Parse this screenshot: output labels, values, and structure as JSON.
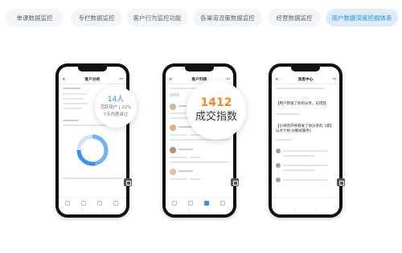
{
  "tabs": [
    {
      "label": "单课数据监控",
      "active": false
    },
    {
      "label": "专栏数据监控",
      "active": false
    },
    {
      "label": "客户行为监控功能",
      "active": false
    },
    {
      "label": "各渠道流量数据监控",
      "active": false
    },
    {
      "label": "经营数据监控",
      "active": false
    },
    {
      "label": "用户数据深度挖掘体系",
      "active": true
    }
  ],
  "phones": [
    {
      "title": "客户分析",
      "close": "×",
      "more": "···",
      "bubble": {
        "value": "14人",
        "line1": "活跃用户 | 22%",
        "line2": "7天内登录过"
      }
    },
    {
      "title": "客户列表",
      "close": "×",
      "more": "···",
      "bubble": {
        "value": "1412",
        "label": "成交指数"
      }
    },
    {
      "title": "消息中心",
      "close": "×",
      "more": "···",
      "messages": [
        "【用户转发了你的分享，记得及",
        "【小炜的开并转发了你分享的《家】",
        "以大计划·分解式服务》"
      ]
    }
  ],
  "nav_glyphs": {
    "back": "‹",
    "forward": "›",
    "share": "⬚"
  },
  "colors": {
    "accent": "#2f8fe6",
    "orange": "#f08a24",
    "donut_light": "#cfe4ff",
    "donut_mid": "#6fb3f5",
    "donut_dark": "#3c8ff0"
  }
}
